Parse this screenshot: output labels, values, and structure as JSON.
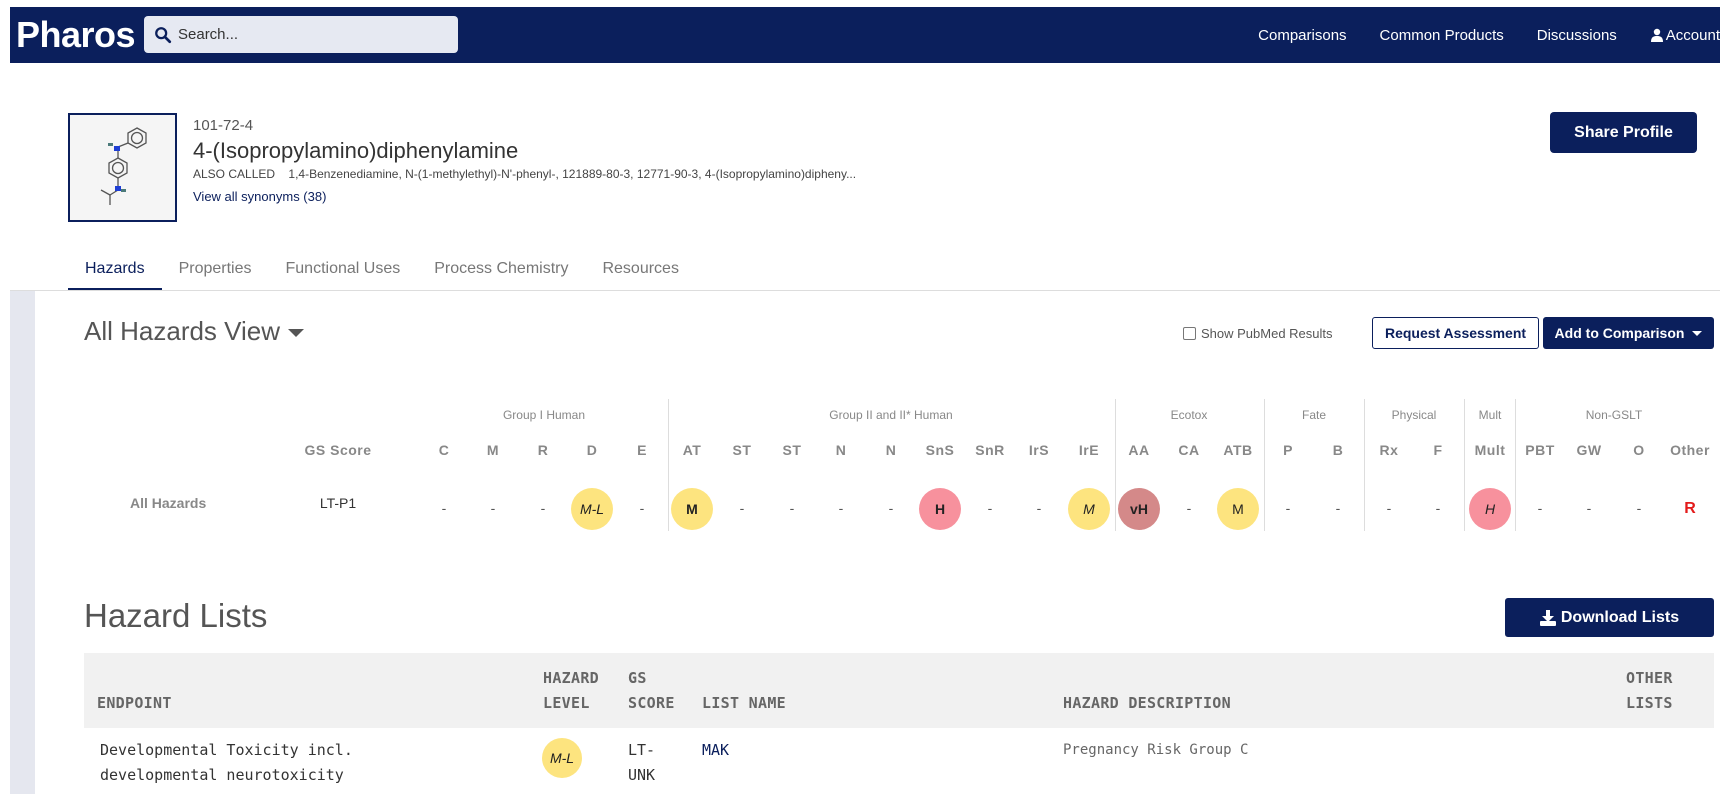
{
  "navbar": {
    "brand": "Pharos",
    "search_placeholder": "Search...",
    "links": [
      "Comparisons",
      "Common Products",
      "Discussions",
      "Account"
    ]
  },
  "chemical": {
    "cas": "101-72-4",
    "name": "4-(Isopropylamino)diphenylamine",
    "also_called_label": "ALSO CALLED",
    "also_called": "1,4-Benzenediamine, N-(1-methylethyl)-N'-phenyl-, 121889-80-3, 12771-90-3, 4-(Isopropylamino)dipheny...",
    "synonyms_link": "View all synonyms (38)",
    "share_label": "Share Profile"
  },
  "tabs": [
    "Hazards",
    "Properties",
    "Functional Uses",
    "Process Chemistry",
    "Resources"
  ],
  "hazards_view": {
    "title": "All Hazards View",
    "pubmed_label": "Show PubMed Results",
    "request_label": "Request Assessment",
    "compare_label": "Add to Comparison",
    "groups": [
      "Group I Human",
      "Group II and II* Human",
      "Ecotox",
      "Fate",
      "Physical",
      "Mult",
      "Non-GSLT"
    ],
    "gs_score_header": "GS Score",
    "row_label": "All Hazards",
    "gs_score_value": "LT-P1",
    "columns": [
      {
        "code": "C",
        "value": "-"
      },
      {
        "code": "M",
        "value": "-"
      },
      {
        "code": "R",
        "value": "-"
      },
      {
        "code": "D",
        "value": "M-L",
        "color": "yellow",
        "style": "italic"
      },
      {
        "code": "E",
        "value": "-"
      },
      {
        "code": "AT",
        "value": "M",
        "color": "yellow",
        "style": "bold"
      },
      {
        "code": "ST",
        "value": "-"
      },
      {
        "code": "ST",
        "value": "-"
      },
      {
        "code": "N",
        "value": "-"
      },
      {
        "code": "N",
        "value": "-"
      },
      {
        "code": "SnS",
        "value": "H",
        "color": "pink",
        "style": "bold"
      },
      {
        "code": "SnR",
        "value": "-"
      },
      {
        "code": "IrS",
        "value": "-"
      },
      {
        "code": "IrE",
        "value": "M",
        "color": "yellow",
        "style": "italic"
      },
      {
        "code": "AA",
        "value": "vH",
        "color": "rose",
        "style": "bold"
      },
      {
        "code": "CA",
        "value": "-"
      },
      {
        "code": "ATB",
        "value": "M",
        "color": "yellow",
        "style": "normal"
      },
      {
        "code": "P",
        "value": "-"
      },
      {
        "code": "B",
        "value": "-"
      },
      {
        "code": "Rx",
        "value": "-"
      },
      {
        "code": "F",
        "value": "-"
      },
      {
        "code": "Mult",
        "value": "H",
        "color": "pink",
        "style": "italic"
      },
      {
        "code": "PBT",
        "value": "-"
      },
      {
        "code": "GW",
        "value": "-"
      },
      {
        "code": "O",
        "value": "-"
      },
      {
        "code": "Other",
        "value": "R",
        "style": "red"
      }
    ]
  },
  "hazard_lists": {
    "title": "Hazard Lists",
    "download_label": "Download Lists",
    "headers": {
      "endpoint": "ENDPOINT",
      "hazard_level_1": "HAZARD",
      "hazard_level_2": "LEVEL",
      "gs_score_1": "GS",
      "gs_score_2": "SCORE",
      "list_name": "LIST NAME",
      "description": "HAZARD DESCRIPTION",
      "other_1": "OTHER",
      "other_2": "LISTS"
    },
    "rows": [
      {
        "endpoint_1": "Developmental Toxicity incl.",
        "endpoint_2": "developmental neurotoxicity",
        "level": "M-L",
        "gs_1": "LT-",
        "gs_2": "UNK",
        "list_name": "MAK",
        "description": "Pregnancy Risk Group C"
      }
    ]
  },
  "colors": {
    "navy": "#0b1f5c",
    "yellow": "#fde47f",
    "pink": "#f7919d",
    "rose": "#d48989",
    "red": "#e31b1b"
  }
}
